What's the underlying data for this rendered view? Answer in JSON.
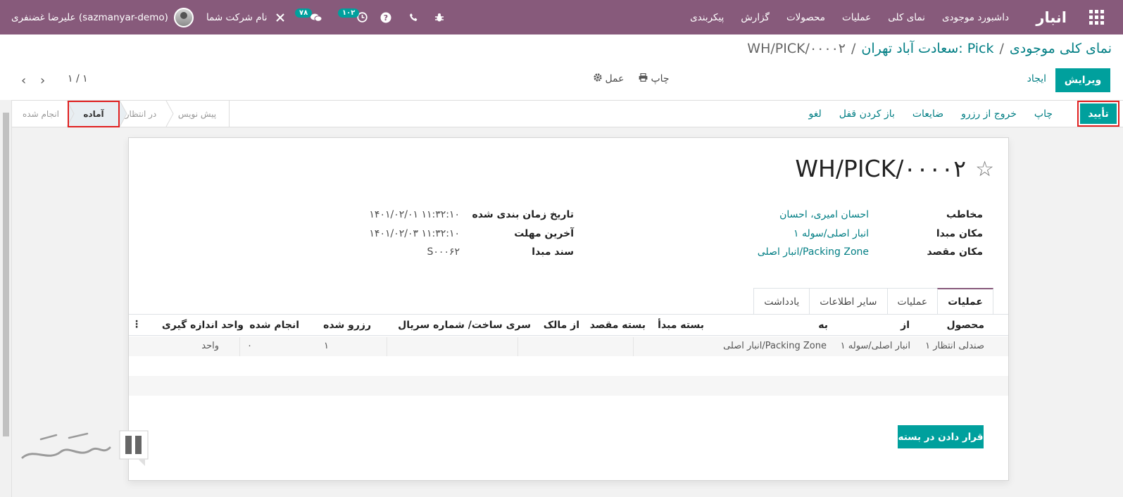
{
  "navbar": {
    "app_title": "انبار",
    "menu": [
      "داشبورد موجودی",
      "نمای کلی",
      "عملیات",
      "محصولات",
      "گزارش",
      "پیکربندی"
    ],
    "company": "نام شرکت شما",
    "user": "علیرضا غضنفری (sazmanyar-demo)",
    "badge_messages": "۷۸",
    "badge_activities": "۱۰۲",
    "colors": {
      "bar": "#875a7b",
      "badge": "#00a09d"
    }
  },
  "breadcrumb": {
    "first": "نمای کلی موجودی",
    "second": "سعادت آباد تهران: Pick",
    "current": "WH/PICK/۰۰۰۰۲",
    "sep": "/"
  },
  "controls": {
    "edit": "ویرایش",
    "create": "ایجاد",
    "print": "چاپ",
    "action": "عمل",
    "pager": "۱ / ۱"
  },
  "statusbar": {
    "confirm": "تأیید",
    "actions": [
      "چاپ",
      "خروج از رزرو",
      "ضایعات",
      "باز کردن قفل",
      "لغو"
    ],
    "stages": {
      "done": "انجام شده",
      "ready": "آماده",
      "waiting": "در انتظار",
      "draft": "پیش نویس"
    }
  },
  "record": {
    "reference": "WH/PICK/۰۰۰۰۲",
    "fields_right": [
      {
        "label": "مخاطب",
        "value": "احسان امیری، احسان"
      },
      {
        "label": "مکان مبدا",
        "value": "انبار اصلی/سوله ۱"
      },
      {
        "label": "مکان مقصد",
        "value": "انبار اصلی/Packing Zone"
      }
    ],
    "fields_left": [
      {
        "label": "تاریخ زمان بندی شده",
        "value": "۱۴۰۱/۰۲/۰۱ ۱۱:۳۲:۱۰"
      },
      {
        "label": "آخرین مهلت",
        "value": "۱۴۰۱/۰۲/۰۳ ۱۱:۳۲:۱۰"
      },
      {
        "label": "سند مبدا",
        "value": "S۰۰۰۶۲"
      }
    ]
  },
  "tabs": [
    "عملیات",
    "عملیات",
    "سایر اطلاعات",
    "یادداشت"
  ],
  "table": {
    "headers": [
      "محصول",
      "از",
      "به",
      "بسته مبدأ",
      "بسته مقصد",
      "از مالک",
      "سری ساخت/ شماره سریال",
      "رزرو شده",
      "انجام شده",
      "واحد اندازه گیری"
    ],
    "rows": [
      [
        "صندلی انتظار ۱",
        "انبار اصلی/سوله ۱",
        "انبار اصلی/Packing Zone",
        "",
        "",
        "",
        "",
        "۱",
        "۰",
        "واحد"
      ]
    ]
  },
  "pack_button": "قرار دادن در بسته",
  "logo_text": "سازمان یار"
}
